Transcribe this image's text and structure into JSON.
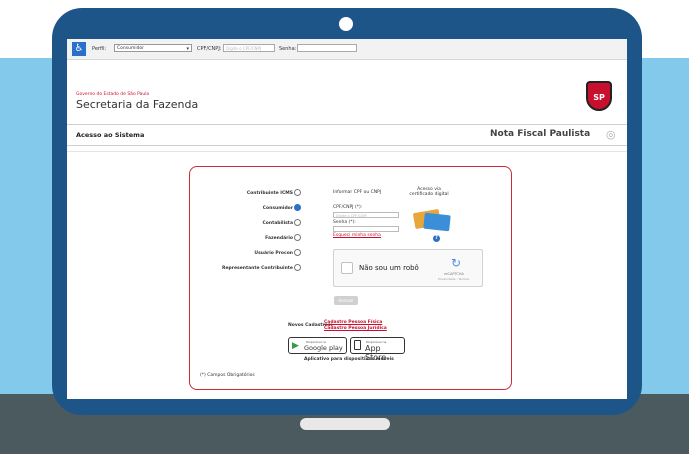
{
  "toolbar": {
    "perfil_label": "Perfil:",
    "perfil_value": "Consumidor",
    "cpf_label": "CPF/CNPJ:",
    "cpf_placeholder": "Digite o CPF/CNPJ",
    "senha_label": "Senha:"
  },
  "header": {
    "gov_label": "Governo do Estado de São Paulo",
    "dept_title": "Secretaria da Fazenda",
    "seal_text": "SP",
    "section_title": "Acesso ao Sistema",
    "product_title": "Nota Fiscal Paulista"
  },
  "login": {
    "roles": [
      {
        "label": "Contribuinte ICMS",
        "selected": false
      },
      {
        "label": "Consumidor",
        "selected": true
      },
      {
        "label": "Contabilista",
        "selected": false
      },
      {
        "label": "Fazendário",
        "selected": false
      },
      {
        "label": "Usuário Procon",
        "selected": false
      },
      {
        "label": "Representante Contribuinte",
        "selected": false
      }
    ],
    "info_text": "Informar CPF ou CNPJ",
    "cert_text": "Acesso via certificado digital",
    "cpf_label": "CPF/CNPJ (*):",
    "cpf_placeholder": "Digite o CPF/CNPJ",
    "senha_label": "Senha (*):",
    "forgot_link": "Esqueci minha senha",
    "captcha_label": "Não sou um robô",
    "captcha_brand": "reCAPTCHA",
    "captcha_links": "Privacidade - Termos",
    "submit_label": "Acessar",
    "new_label": "Novos Cadastros:",
    "new_pf": "Cadastro Pessoa Física",
    "new_pj": "Cadastro Pessoa Jurídica",
    "google_small": "Disponível no",
    "google_big": "Google play",
    "apple_small": "Disponível na",
    "apple_big": "App Store",
    "apps_label": "Aplicativo para dispositivos móveis",
    "required_label": "(*) Campos Obrigatórios"
  },
  "colors": {
    "bezel": "#1e5589",
    "sky": "#83c9ec",
    "base": "#4a5a5f",
    "accent_red": "#c8102e"
  },
  "icons": {
    "accessibility": "wheelchair-icon",
    "seal": "sao-paulo-seal-icon",
    "nfp": "nfp-logo-icon",
    "help": "help-icon",
    "captcha": "recaptcha-icon",
    "google": "google-play-icon",
    "apple": "apple-icon"
  }
}
